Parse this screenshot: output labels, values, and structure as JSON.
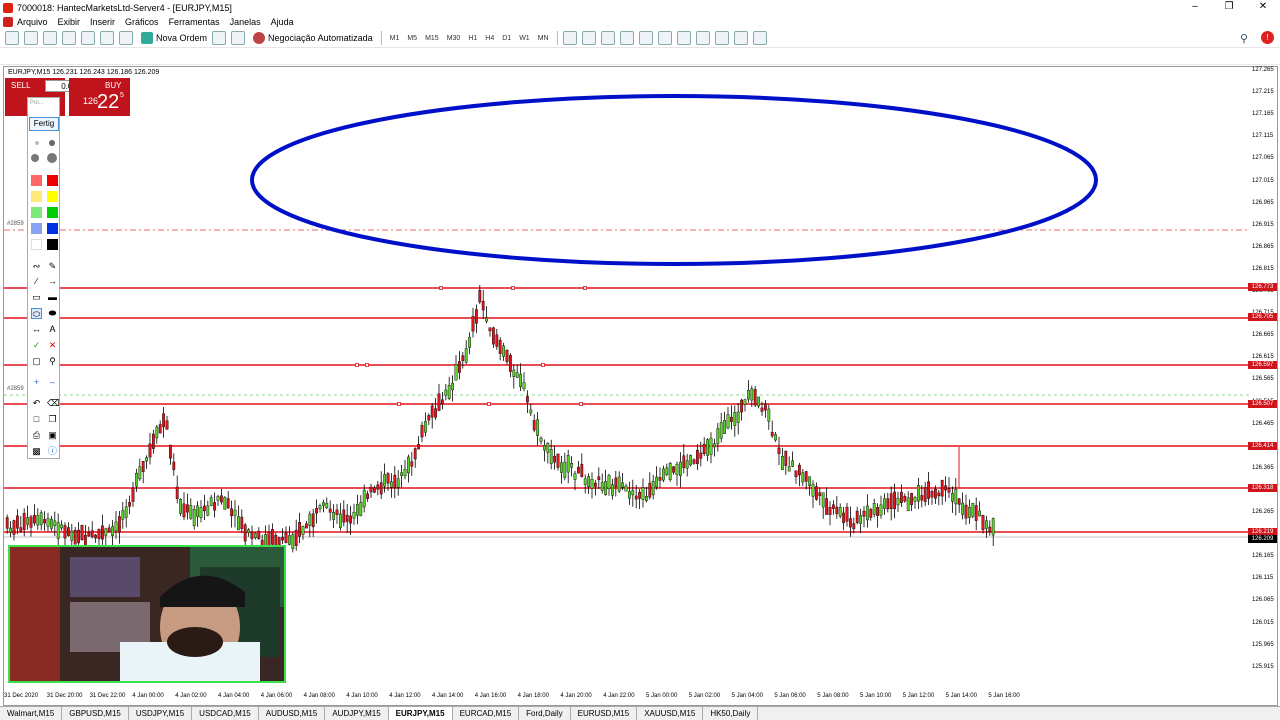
{
  "window": {
    "title": "7000018: HantecMarketsLtd-Server4 - [EURJPY,M15]"
  },
  "menu": [
    "Arquivo",
    "Exibir",
    "Inserir",
    "Gráficos",
    "Ferramentas",
    "Janelas",
    "Ajuda"
  ],
  "toolbar": {
    "new_order": "Nova Ordem",
    "autotrading": "Negociação Automatizada",
    "timeframes": [
      "M1",
      "M5",
      "M15",
      "M30",
      "H1",
      "H4",
      "D1",
      "W1",
      "MN"
    ]
  },
  "chart": {
    "symbol_info": "EURJPY,M15 126.231 126.243 126.186 126.209",
    "sell_label": "SELL",
    "buy_label": "BUY",
    "lot": "0.01",
    "buy_price_small": "126",
    "buy_price_big": "22",
    "buy_price_super": "5",
    "level_labels": [
      "#2859",
      "#2859"
    ],
    "price_axis": [
      "127.265",
      "127.215",
      "127.165",
      "127.115",
      "127.065",
      "127.015",
      "126.965",
      "126.915",
      "126.865",
      "126.815",
      "126.765",
      "126.715",
      "126.665",
      "126.615",
      "126.565",
      "126.515",
      "126.465",
      "126.415",
      "126.365",
      "126.315",
      "126.265",
      "126.215",
      "126.165",
      "126.115",
      "126.065",
      "126.015",
      "125.965",
      "125.915"
    ],
    "price_tags": [
      "126.773",
      "126.705",
      "126.597",
      "126.507",
      "126.414",
      "126.318",
      "126.219",
      "126.209"
    ],
    "time_axis": [
      "31 Dec 2020",
      "31 Dec 20:00",
      "31 Dec 22:00",
      "4 Jan 00:00",
      "4 Jan 02:00",
      "4 Jan 04:00",
      "4 Jan 06:00",
      "4 Jan 08:00",
      "4 Jan 10:00",
      "4 Jan 12:00",
      "4 Jan 14:00",
      "4 Jan 16:00",
      "4 Jan 18:00",
      "4 Jan 20:00",
      "4 Jan 22:00",
      "5 Jan 00:00",
      "5 Jan 02:00",
      "5 Jan 04:00",
      "5 Jan 06:00",
      "5 Jan 08:00",
      "5 Jan 10:00",
      "5 Jan 12:00",
      "5 Jan 14:00",
      "5 Jan 16:00"
    ]
  },
  "drawing_panel": {
    "pen_label": "Poi...",
    "done_label": "Fertig"
  },
  "tabs": [
    "Walmart,M15",
    "GBPUSD,M15",
    "USDJPY,M15",
    "USDCAD,M15",
    "AUDUSD,M15",
    "AUDJPY,M15",
    "EURJPY,M15",
    "EURCAD,M15",
    "Ford,Daily",
    "EURUSD,M15",
    "XAUUSD,M15",
    "HK50,Daily"
  ],
  "active_tab": "EURJPY,M15",
  "colors": {
    "level_line": "#e0141c",
    "ellipse": "#0010c8",
    "bull": "#5bd12a",
    "bear": "#e0141c"
  }
}
